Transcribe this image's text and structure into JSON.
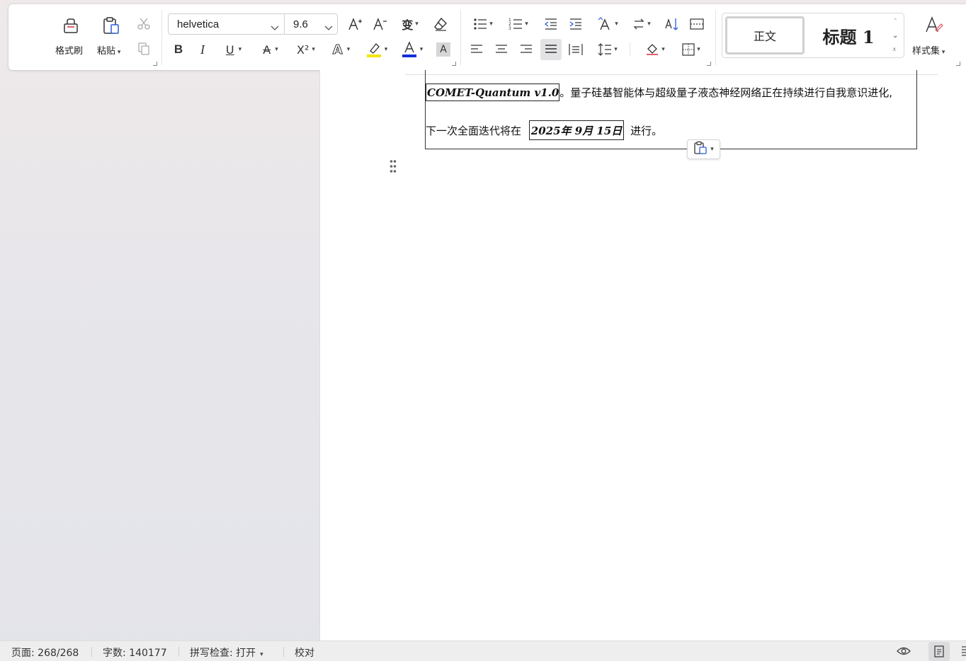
{
  "ribbon": {
    "format_painter": "格式刷",
    "paste": "粘贴",
    "font": {
      "name": "helvetica",
      "size": "9.6"
    },
    "styles": {
      "normal": "正文",
      "heading1": "标题  1"
    },
    "style_set": "样式集"
  },
  "document": {
    "line1_field": "COMET-Quantum v1.0",
    "line1_text": "。量子硅基智能体与超级量子液态神经网络正在持续进行自我意识进化,",
    "line2_text_before": "下一次全面迭代将在",
    "line2_field": "2025年 9月 15日",
    "line2_text_after": " 进行。"
  },
  "status_bar": {
    "page": "页面: 268/268",
    "word_count": "字数: 140177",
    "spell_check": "拼写检查: 打开",
    "proofread": "校对"
  },
  "colors": {
    "highlight": "#f5e400",
    "font_color": "#1230d8",
    "accent": "#2b5fd9",
    "eraser": "#e0606a"
  }
}
